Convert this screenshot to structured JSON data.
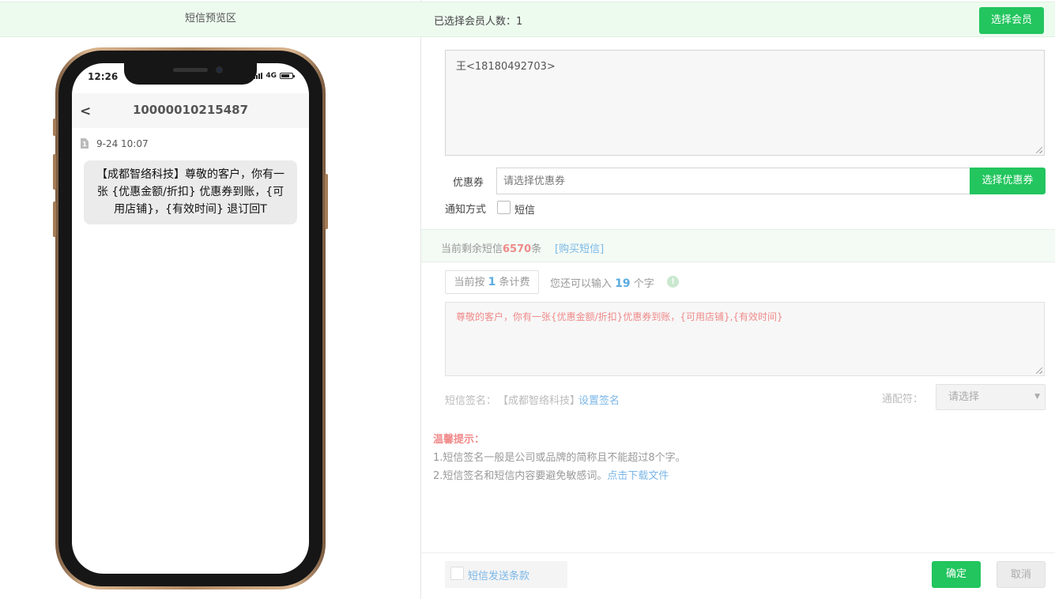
{
  "preview": {
    "title": "短信预览区",
    "status_time": "12:26",
    "status_network": "4G",
    "battery_level": 0.75,
    "sender_number": "10000010215487",
    "back_symbol": "<",
    "sim_slot": "1",
    "message_date": "9-24  10:07",
    "message_text": "【成都智络科技】尊敬的客户，你有一张 {优惠金额/折扣} 优惠券到账，{可用店铺}，{有效时间} 退订回T"
  },
  "header": {
    "selected_count_label": "已选择会员人数：",
    "selected_count": "1",
    "select_member_button": "选择会员"
  },
  "members": {
    "value": "王<18180492703>"
  },
  "coupon": {
    "label": "优惠券",
    "placeholder": "请选择优惠券",
    "button": "选择优惠券"
  },
  "notify": {
    "label": "通知方式",
    "sms_option": "短信",
    "sms_checked": false
  },
  "quota": {
    "prefix": "当前剩余短信",
    "count": "6570",
    "suffix": "条",
    "buy_link": "[购买短信]"
  },
  "billing": {
    "prefix": "当前按",
    "count": "1",
    "suffix": "条计费",
    "remain_prefix": "您还可以输入",
    "remain_count": "19",
    "remain_suffix": "个字",
    "info_icon": "!"
  },
  "content": {
    "value": "尊敬的客户，你有一张{优惠金额/折扣}优惠券到账，{可用店铺},{有效时间}"
  },
  "signature": {
    "label": "短信签名：",
    "value": "【成都智络科技】",
    "link": "设置签名"
  },
  "wildcard": {
    "label": "通配符：",
    "selected": "请选择"
  },
  "tips": {
    "title": "温馨提示：",
    "tip1": "1.短信签名一般是公司或品牌的简称且不能超过8个字。",
    "tip2_text": "2.短信签名和短信内容要避免敏感词。",
    "tip2_link": "点击下载文件"
  },
  "footer": {
    "terms_label": "短信发送条款",
    "confirm_button": "确定",
    "cancel_button": "取消"
  },
  "colors": {
    "accent": "#22c55e",
    "header_bg": "#edfbef",
    "link": "#7bb7e8",
    "warning": "#f08a8a"
  }
}
